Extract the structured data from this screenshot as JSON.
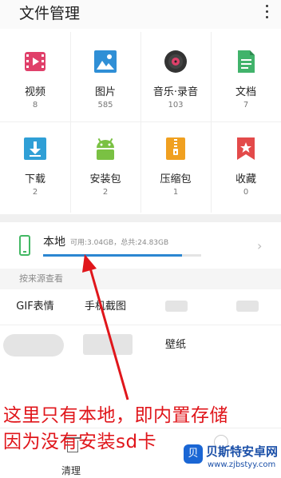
{
  "header": {
    "title": "文件管理"
  },
  "categories": [
    {
      "label": "视频",
      "count": "8",
      "icon": "video-icon",
      "color": "#e0406a"
    },
    {
      "label": "图片",
      "count": "585",
      "icon": "image-icon",
      "color": "#2f8fd6"
    },
    {
      "label": "音乐·录音",
      "count": "103",
      "icon": "music-icon",
      "color": "#333333"
    },
    {
      "label": "文档",
      "count": "7",
      "icon": "document-icon",
      "color": "#41b36b"
    },
    {
      "label": "下载",
      "count": "2",
      "icon": "download-icon",
      "color": "#2f9fd6"
    },
    {
      "label": "安装包",
      "count": "2",
      "icon": "android-icon",
      "color": "#7ac143"
    },
    {
      "label": "压缩包",
      "count": "1",
      "icon": "zip-icon",
      "color": "#f0a020"
    },
    {
      "label": "收藏",
      "count": "0",
      "icon": "bookmark-icon",
      "color": "#e34a4a"
    }
  ],
  "storage": {
    "name": "本地",
    "detail": "可用:3.04GB，总共:24.83GB",
    "used_fraction": 0.88
  },
  "sources": {
    "title": "按来源查看",
    "items": [
      "GIF表情",
      "手机截图",
      "壁纸"
    ]
  },
  "bottom": {
    "clean_label": "清理"
  },
  "annotation": {
    "line1": "这里只有本地，即内置存储",
    "line2": "因为没有安装sd卡"
  },
  "watermark": {
    "name": "贝斯特安卓网",
    "url": "www.zjbstyy.com",
    "badge": "贝"
  },
  "colors": {
    "accent": "#2b86d1",
    "annotation": "#e0161b",
    "storage_icon": "#43b864"
  }
}
